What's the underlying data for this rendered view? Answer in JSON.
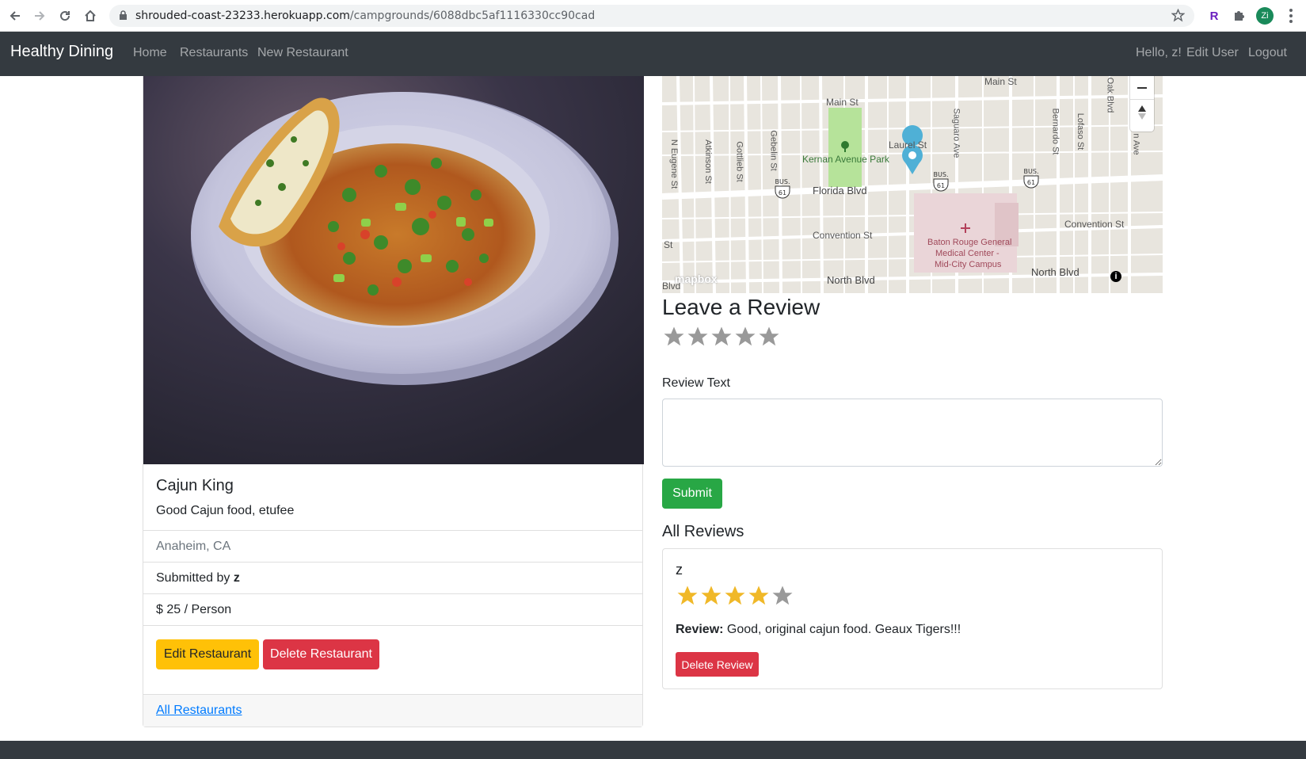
{
  "browser": {
    "url_host": "shrouded-coast-23233.herokuapp.com",
    "url_path": "/campgrounds/6088dbc5af1116330cc90cad",
    "profile_initials": "Zi"
  },
  "navbar": {
    "brand": "Healthy Dining",
    "links": [
      "Home",
      "Restaurants",
      "New Restaurant"
    ],
    "greeting": "Hello, z!",
    "edit_user": "Edit User",
    "logout": "Logout"
  },
  "restaurant": {
    "title": "Cajun King",
    "description": "Good Cajun food, etufee",
    "location": "Anaheim, CA",
    "submitted_prefix": "Submitted by ",
    "submitted_user": "z",
    "price": "$ 25 / Person",
    "edit_label": "Edit Restaurant",
    "delete_label": "Delete Restaurant",
    "all_link": "All Restaurants"
  },
  "map": {
    "attribution": "mapbox",
    "streets": {
      "main_st_top": "Main St",
      "main_st": "Main St",
      "laurel_st": "Laurel St",
      "park": "Kernan Avenue Park",
      "florida": "Florida Blvd",
      "convention_left": "Convention St",
      "convention_right": "Convention St",
      "north_blvd_left": "North Blvd",
      "north_blvd_right": "North Blvd",
      "hospital_1": "Baton Rouge General",
      "hospital_2": "Medical Center -",
      "hospital_3": "Mid-City Campus",
      "n_eugene": "N Eugene St",
      "atkinson": "Atkinson St",
      "gottlieb": "Gottlieb St",
      "gebelin": "Gebelin St",
      "saguaro": "Saguaro Ave",
      "bernardo": "Bernardo St",
      "lofaso": "Lofaso St",
      "oak": "Oak Blvd",
      "n_ave": "n Ave",
      "st_left": "St",
      "blvd_left": "Blvd",
      "bus_shield": "61",
      "bus_label": "BUS."
    }
  },
  "review_form": {
    "heading": "Leave a Review",
    "rating_stars": 0,
    "text_label": "Review Text",
    "textarea_value": "",
    "submit_label": "Submit"
  },
  "reviews": {
    "heading": "All Reviews",
    "items": [
      {
        "user": "z",
        "rating": 4,
        "label": "Review:",
        "text": " Good, original cajun food. Geaux Tigers!!!",
        "delete_label": "Delete Review"
      }
    ]
  },
  "colors": {
    "navbar_bg": "#343a40",
    "star_filled": "#f0b828",
    "star_empty": "#999999",
    "warning": "#ffc107",
    "danger": "#dc3545",
    "success": "#28a745",
    "link": "#007bff"
  }
}
